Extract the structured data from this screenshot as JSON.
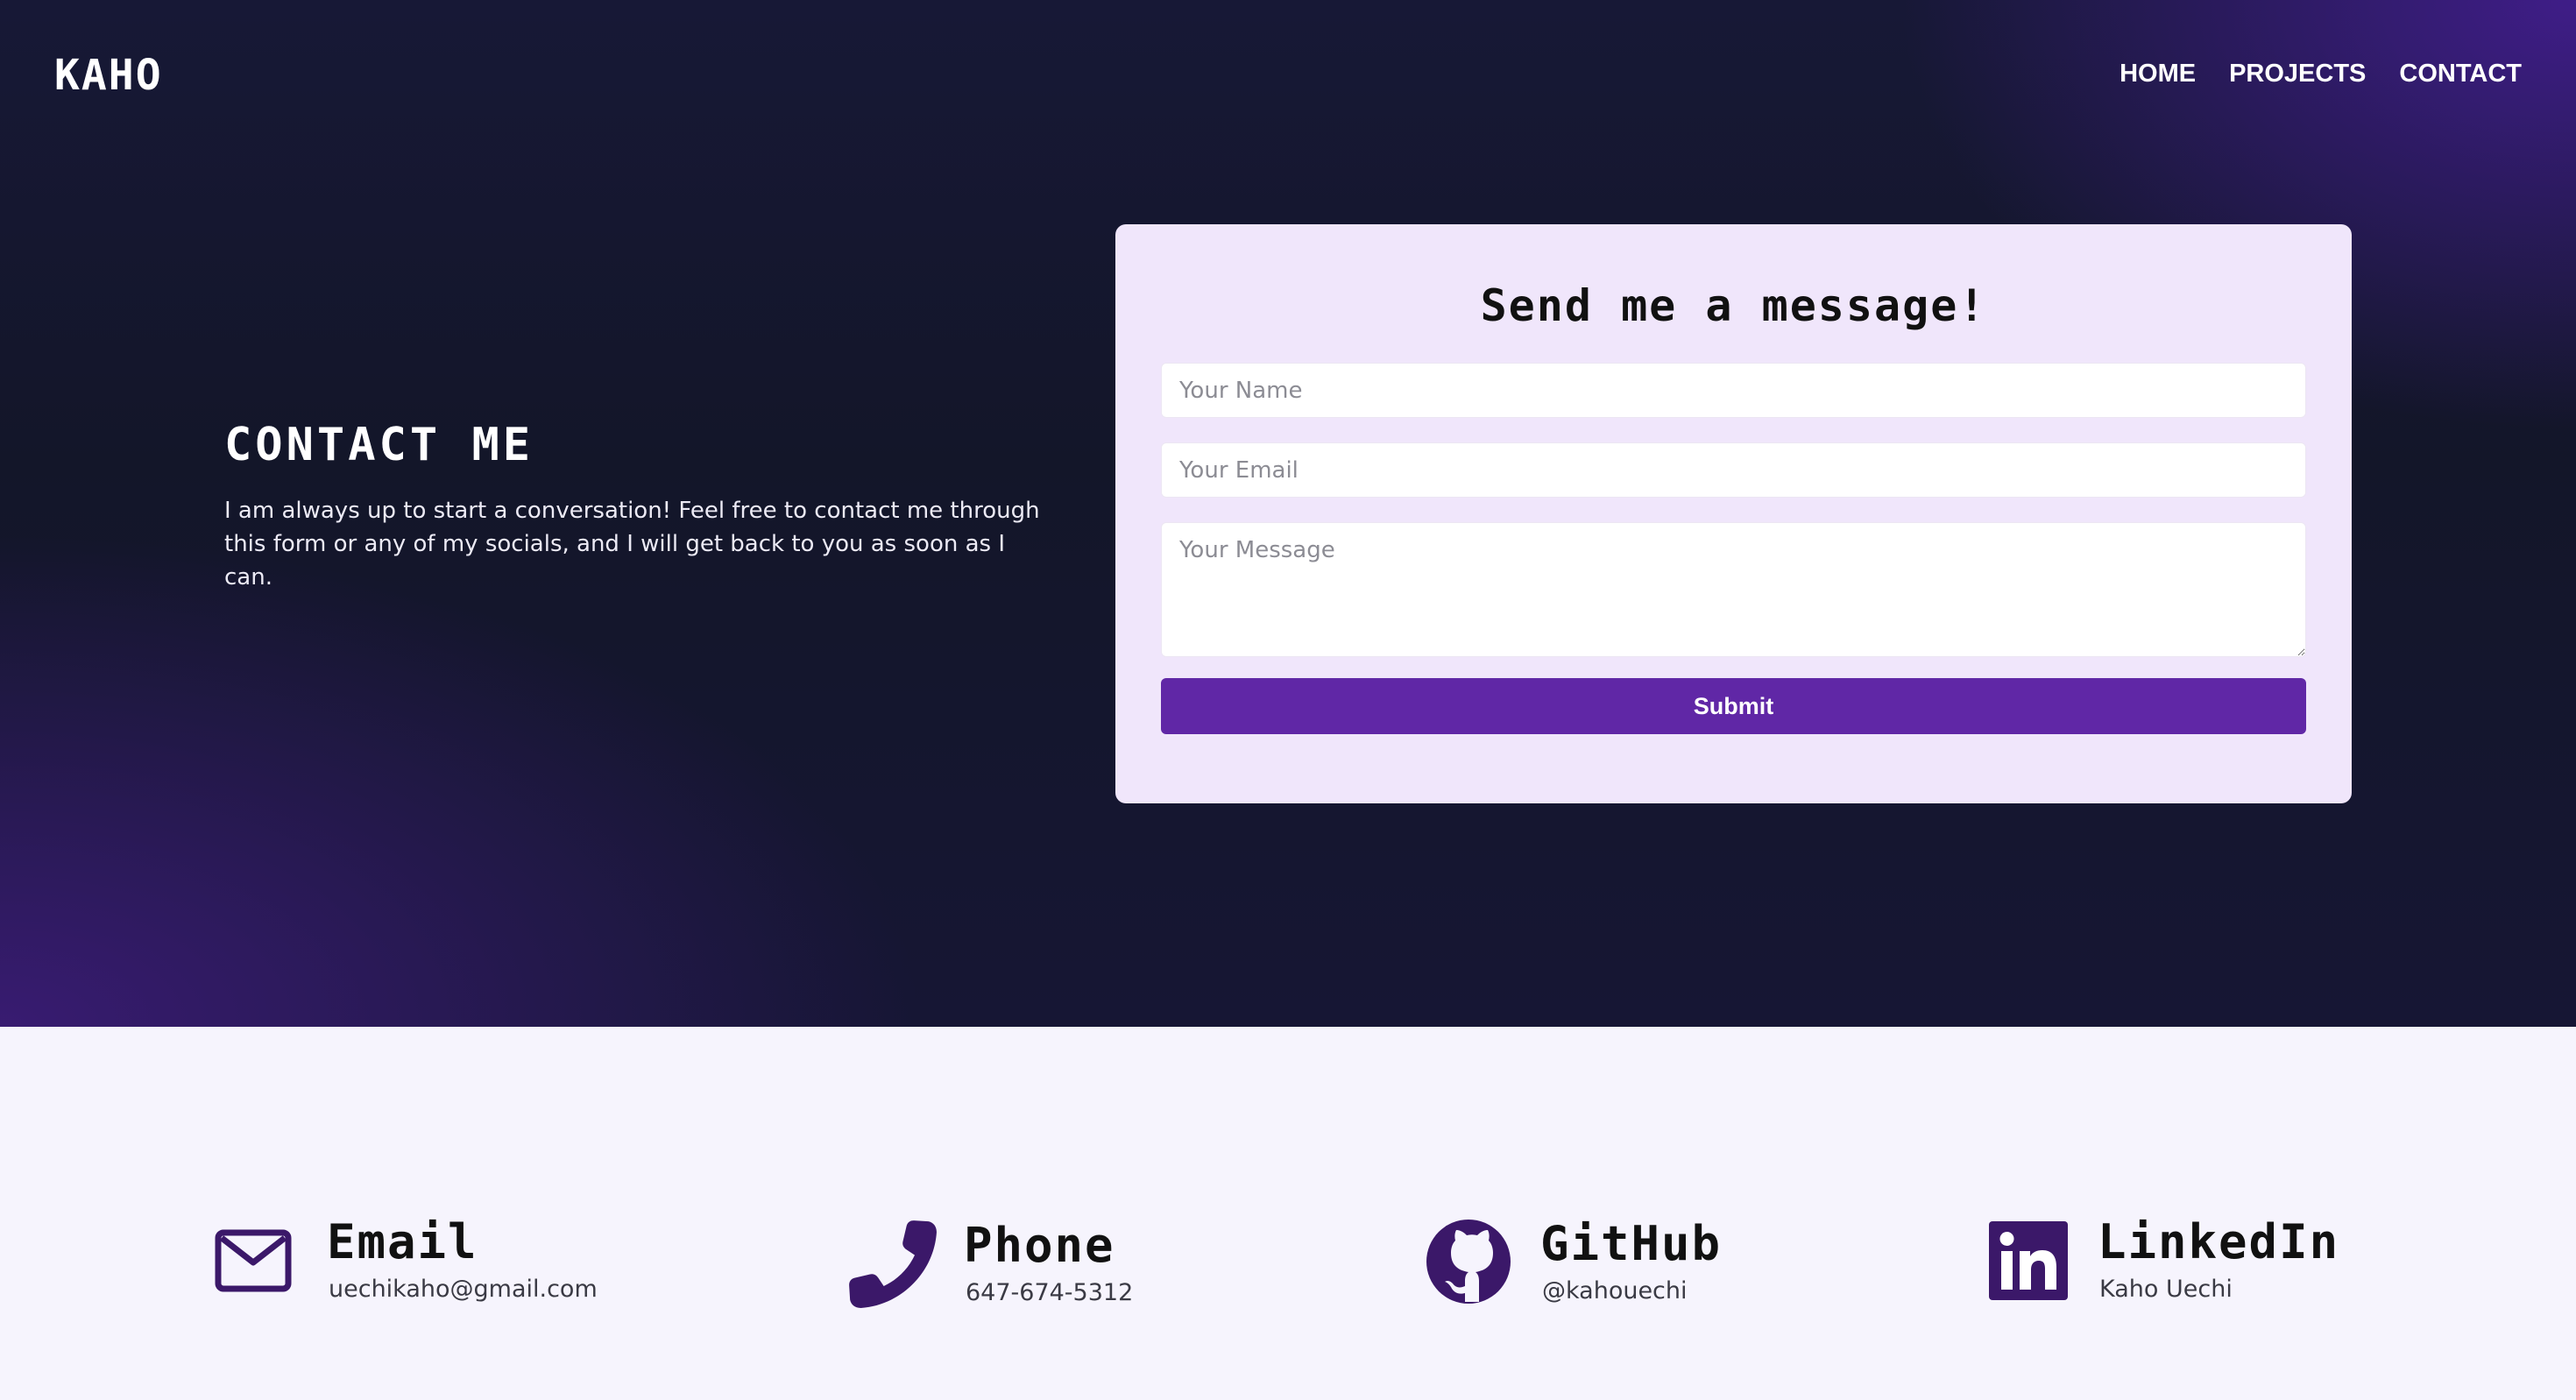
{
  "header": {
    "logo": "KAHO",
    "nav": [
      "HOME",
      "PROJECTS",
      "CONTACT"
    ]
  },
  "intro": {
    "title": "CONTACT ME",
    "body": "I am always up to start a conversation! Feel free to contact me through this form or any of my socials, and I will get back to you as soon as I can."
  },
  "form": {
    "title": "Send me a message!",
    "name_placeholder": "Your Name",
    "email_placeholder": "Your Email",
    "message_placeholder": "Your Message",
    "submit_label": "Submit"
  },
  "contacts": [
    {
      "label": "Email",
      "value": "uechikaho@gmail.com",
      "icon": "envelope-icon"
    },
    {
      "label": "Phone",
      "value": "647-674-5312",
      "icon": "phone-icon"
    },
    {
      "label": "GitHub",
      "value": "@kahouechi",
      "icon": "github-icon"
    },
    {
      "label": "LinkedIn",
      "value": "Kaho Uechi",
      "icon": "linkedin-icon"
    }
  ],
  "colors": {
    "accent": "#6027a6",
    "icon": "#3b1869",
    "card": "#f0e6fb",
    "page_bg": "#f6f4fd"
  }
}
